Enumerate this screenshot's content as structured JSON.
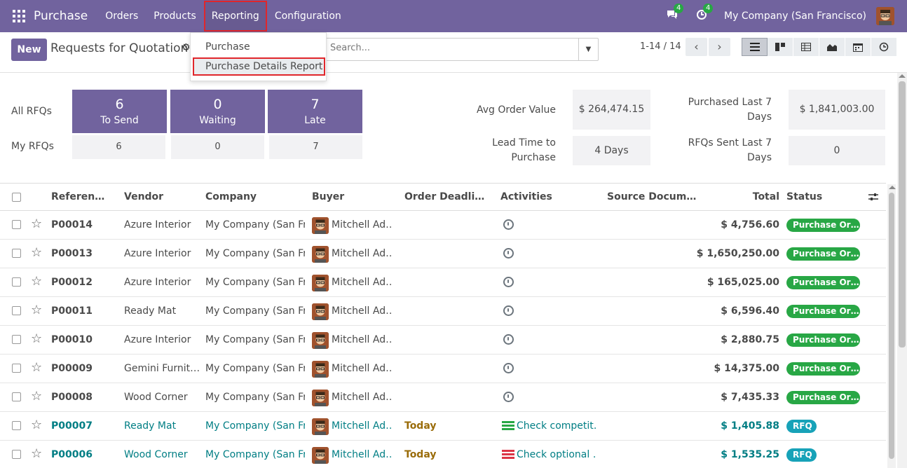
{
  "navbar": {
    "app_name": "Purchase",
    "menu": [
      "Orders",
      "Products",
      "Reporting",
      "Configuration"
    ],
    "messages_badge": "4",
    "activities_badge": "4",
    "company": "My Company (San Francisco)"
  },
  "reporting_menu": {
    "items": [
      "Purchase",
      "Purchase Details Report"
    ]
  },
  "control_panel": {
    "new_label": "New",
    "title": "Requests for Quotation",
    "search_placeholder": "Search...",
    "pager": "1-14 / 14"
  },
  "dashboard": {
    "all_rfqs_label": "All RFQs",
    "my_rfqs_label": "My RFQs",
    "tiles": [
      {
        "value": "6",
        "caption": "To Send",
        "my": "6"
      },
      {
        "value": "0",
        "caption": "Waiting",
        "my": "0"
      },
      {
        "value": "7",
        "caption": "Late",
        "my": "7"
      }
    ],
    "kpis": {
      "avg_order_label": "Avg Order Value",
      "avg_order_value": "$ 264,474.15",
      "purchased_label_1": "Purchased Last 7",
      "purchased_label_2": "Days",
      "purchased_value": "$ 1,841,003.00",
      "lead_time_label_1": "Lead Time to",
      "lead_time_label_2": "Purchase",
      "lead_time_value": "4 Days",
      "sent_label_1": "RFQs Sent Last 7",
      "sent_label_2": "Days",
      "sent_value": "0"
    }
  },
  "table": {
    "headers": [
      "Referen…",
      "Vendor",
      "Company",
      "Buyer",
      "Order Deadli…",
      "Activities",
      "Source Docum…",
      "Total",
      "Status"
    ],
    "rows": [
      {
        "ref": "P00014",
        "vendor": "Azure Interior",
        "company": "My Company (San Fr…",
        "buyer": "Mitchell Ad…",
        "deadline": "",
        "activity": "",
        "total": "$ 4,756.60",
        "status": "Purchase Or…"
      },
      {
        "ref": "P00013",
        "vendor": "Azure Interior",
        "company": "My Company (San Fr…",
        "buyer": "Mitchell Ad…",
        "deadline": "",
        "activity": "",
        "total": "$ 1,650,250.00",
        "status": "Purchase Or…"
      },
      {
        "ref": "P00012",
        "vendor": "Azure Interior",
        "company": "My Company (San Fr…",
        "buyer": "Mitchell Ad…",
        "deadline": "",
        "activity": "",
        "total": "$ 165,025.00",
        "status": "Purchase Or…"
      },
      {
        "ref": "P00011",
        "vendor": "Ready Mat",
        "company": "My Company (San Fr…",
        "buyer": "Mitchell Ad…",
        "deadline": "",
        "activity": "",
        "total": "$ 6,596.40",
        "status": "Purchase Or…"
      },
      {
        "ref": "P00010",
        "vendor": "Azure Interior",
        "company": "My Company (San Fr…",
        "buyer": "Mitchell Ad…",
        "deadline": "",
        "activity": "",
        "total": "$ 2,880.75",
        "status": "Purchase Or…"
      },
      {
        "ref": "P00009",
        "vendor": "Gemini Furnit…",
        "company": "My Company (San Fr…",
        "buyer": "Mitchell Ad…",
        "deadline": "",
        "activity": "",
        "total": "$ 14,375.00",
        "status": "Purchase Or…"
      },
      {
        "ref": "P00008",
        "vendor": "Wood Corner",
        "company": "My Company (San Fr…",
        "buyer": "Mitchell Ad…",
        "deadline": "",
        "activity": "",
        "total": "$ 7,435.33",
        "status": "Purchase Or…"
      },
      {
        "ref": "P00007",
        "vendor": "Ready Mat",
        "company": "My Company (San Fr…",
        "buyer": "Mitchell Ad…",
        "deadline": "Today",
        "activity": "Check competit…",
        "total": "$ 1,405.88",
        "status": "RFQ"
      },
      {
        "ref": "P00006",
        "vendor": "Wood Corner",
        "company": "My Company (San Fr…",
        "buyer": "Mitchell Ad…",
        "deadline": "Today",
        "activity": "Check optional …",
        "total": "$ 1,535.25",
        "status": "RFQ"
      }
    ]
  },
  "colors": {
    "brand": "#71639e",
    "highlight_border": "#e0262b",
    "status_purchase": "#28a745",
    "status_rfq": "#17a2b8",
    "link": "#017e84"
  }
}
